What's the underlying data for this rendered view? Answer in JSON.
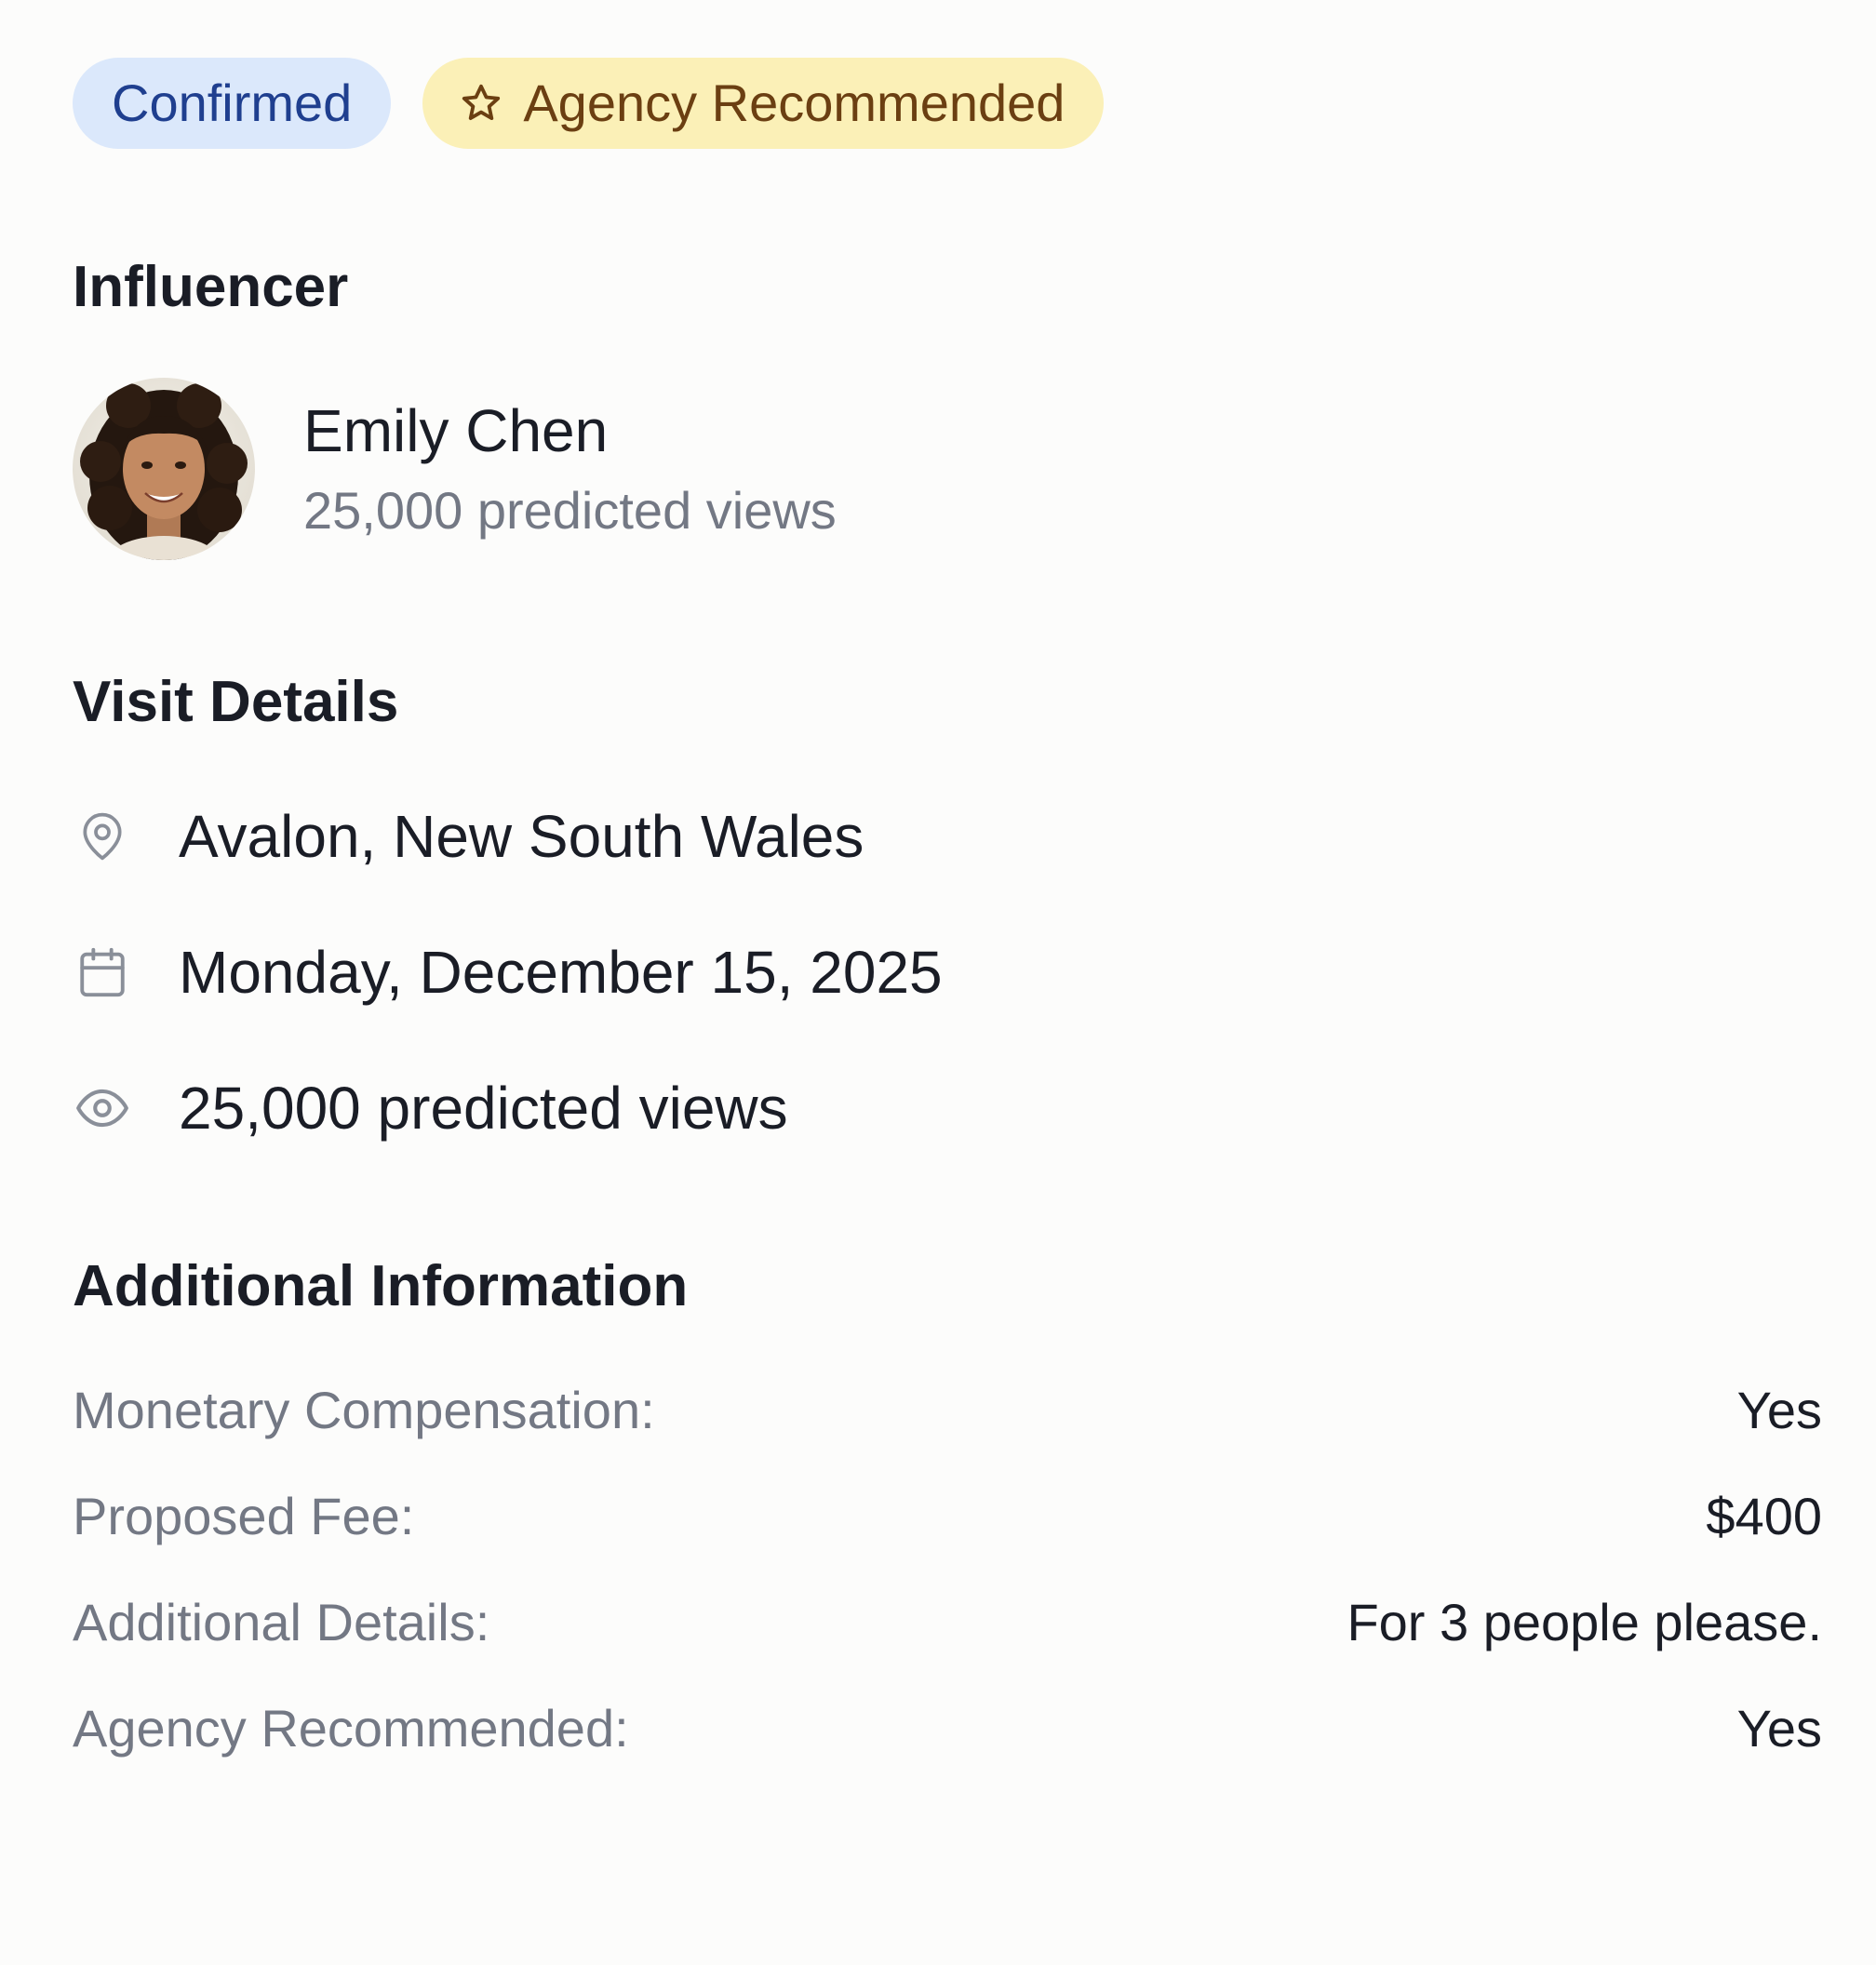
{
  "badges": {
    "confirmed": "Confirmed",
    "agency_recommended": "Agency Recommended"
  },
  "influencer": {
    "section_title": "Influencer",
    "name": "Emily Chen",
    "predicted_views": "25,000 predicted views",
    "avatar_icon": "avatar-photo"
  },
  "visit_details": {
    "section_title": "Visit Details",
    "location": {
      "icon": "map-pin-icon",
      "text": "Avalon, New South Wales"
    },
    "date": {
      "icon": "calendar-icon",
      "text": "Monday, December 15, 2025"
    },
    "views": {
      "icon": "eye-icon",
      "text": "25,000 predicted views"
    }
  },
  "additional_info": {
    "section_title": "Additional Information",
    "rows": [
      {
        "label": "Monetary Compensation:",
        "value": "Yes"
      },
      {
        "label": "Proposed Fee:",
        "value": "$400"
      },
      {
        "label": "Additional Details:",
        "value": "For 3 people please."
      },
      {
        "label": "Agency Recommended:",
        "value": "Yes"
      }
    ]
  },
  "colors": {
    "confirmed_badge_bg": "#dbe8fb",
    "confirmed_badge_text": "#1f3f8f",
    "agency_badge_bg": "#fbf0b7",
    "agency_badge_text": "#6b3f12",
    "heading_text": "#1a1d26",
    "muted_text": "#737884",
    "icon_gray": "#8a8f99"
  }
}
